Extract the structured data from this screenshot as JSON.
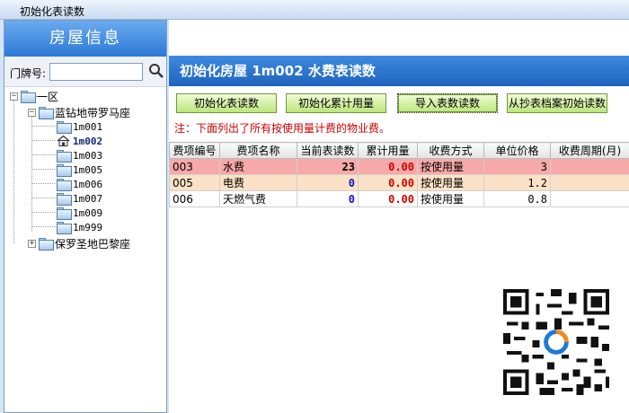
{
  "window": {
    "title": "初始化表读数"
  },
  "sidebar": {
    "title": "房屋信息",
    "search_label": "门牌号:",
    "search_value": "",
    "tree": {
      "root": "一区",
      "building1": "蓝钻地带罗马座",
      "units": [
        "1m001",
        "1m002",
        "1m003",
        "1m005",
        "1m006",
        "1m007",
        "1m009",
        "1m999"
      ],
      "selected": "1m002",
      "building2": "保罗圣地巴黎座"
    }
  },
  "main": {
    "header": "初始化房屋 1m002 水费表读数",
    "buttons": [
      "初始化表读数",
      "初始化累计用量",
      "导入表数读数",
      "从抄表档案初始读数"
    ],
    "note": "注：下面列出了所有按使用量计费的物业费。",
    "columns": [
      "费项编号",
      "费项名称",
      "当前表读数",
      "累计用量",
      "收费方式",
      "单位价格",
      "收费周期(月)"
    ],
    "rows": [
      {
        "code": "003",
        "name": "水费",
        "reading": "23",
        "usage": "0.00",
        "method": "按使用量",
        "price": "3",
        "cycle": ""
      },
      {
        "code": "005",
        "name": "电费",
        "reading": "0",
        "usage": "0.00",
        "method": "按使用量",
        "price": "1.2",
        "cycle": ""
      },
      {
        "code": "006",
        "name": "天燃气费",
        "reading": "0",
        "usage": "0.00",
        "method": "按使用量",
        "price": "0.8",
        "cycle": ""
      }
    ]
  },
  "icons": [
    "search-icon",
    "folder-icon",
    "house-icon",
    "qr-code"
  ],
  "colors": {
    "header_blue": "#2c79d6",
    "button_green": "#bce67a",
    "selected_row": "#f7a9a9",
    "alt_row": "#fbe1c6",
    "note_red": "#cc0000"
  }
}
